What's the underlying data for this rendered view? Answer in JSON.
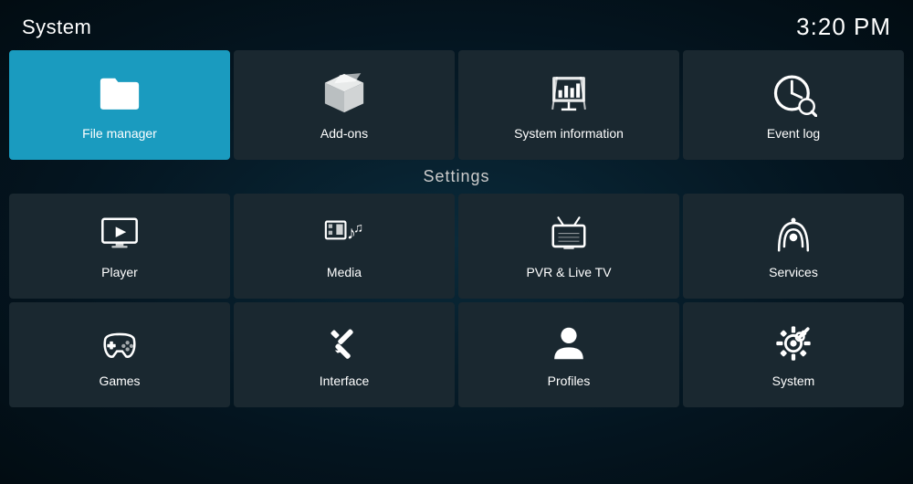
{
  "header": {
    "title": "System",
    "clock": "3:20 PM"
  },
  "top_menu": {
    "items": [
      {
        "id": "file-manager",
        "label": "File manager",
        "active": true
      },
      {
        "id": "add-ons",
        "label": "Add-ons",
        "active": false
      },
      {
        "id": "system-information",
        "label": "System information",
        "active": false
      },
      {
        "id": "event-log",
        "label": "Event log",
        "active": false
      }
    ]
  },
  "settings": {
    "title": "Settings",
    "items": [
      {
        "id": "player",
        "label": "Player"
      },
      {
        "id": "media",
        "label": "Media"
      },
      {
        "id": "pvr-live-tv",
        "label": "PVR & Live TV"
      },
      {
        "id": "services",
        "label": "Services"
      },
      {
        "id": "games",
        "label": "Games"
      },
      {
        "id": "interface",
        "label": "Interface"
      },
      {
        "id": "profiles",
        "label": "Profiles"
      },
      {
        "id": "system",
        "label": "System"
      }
    ]
  }
}
